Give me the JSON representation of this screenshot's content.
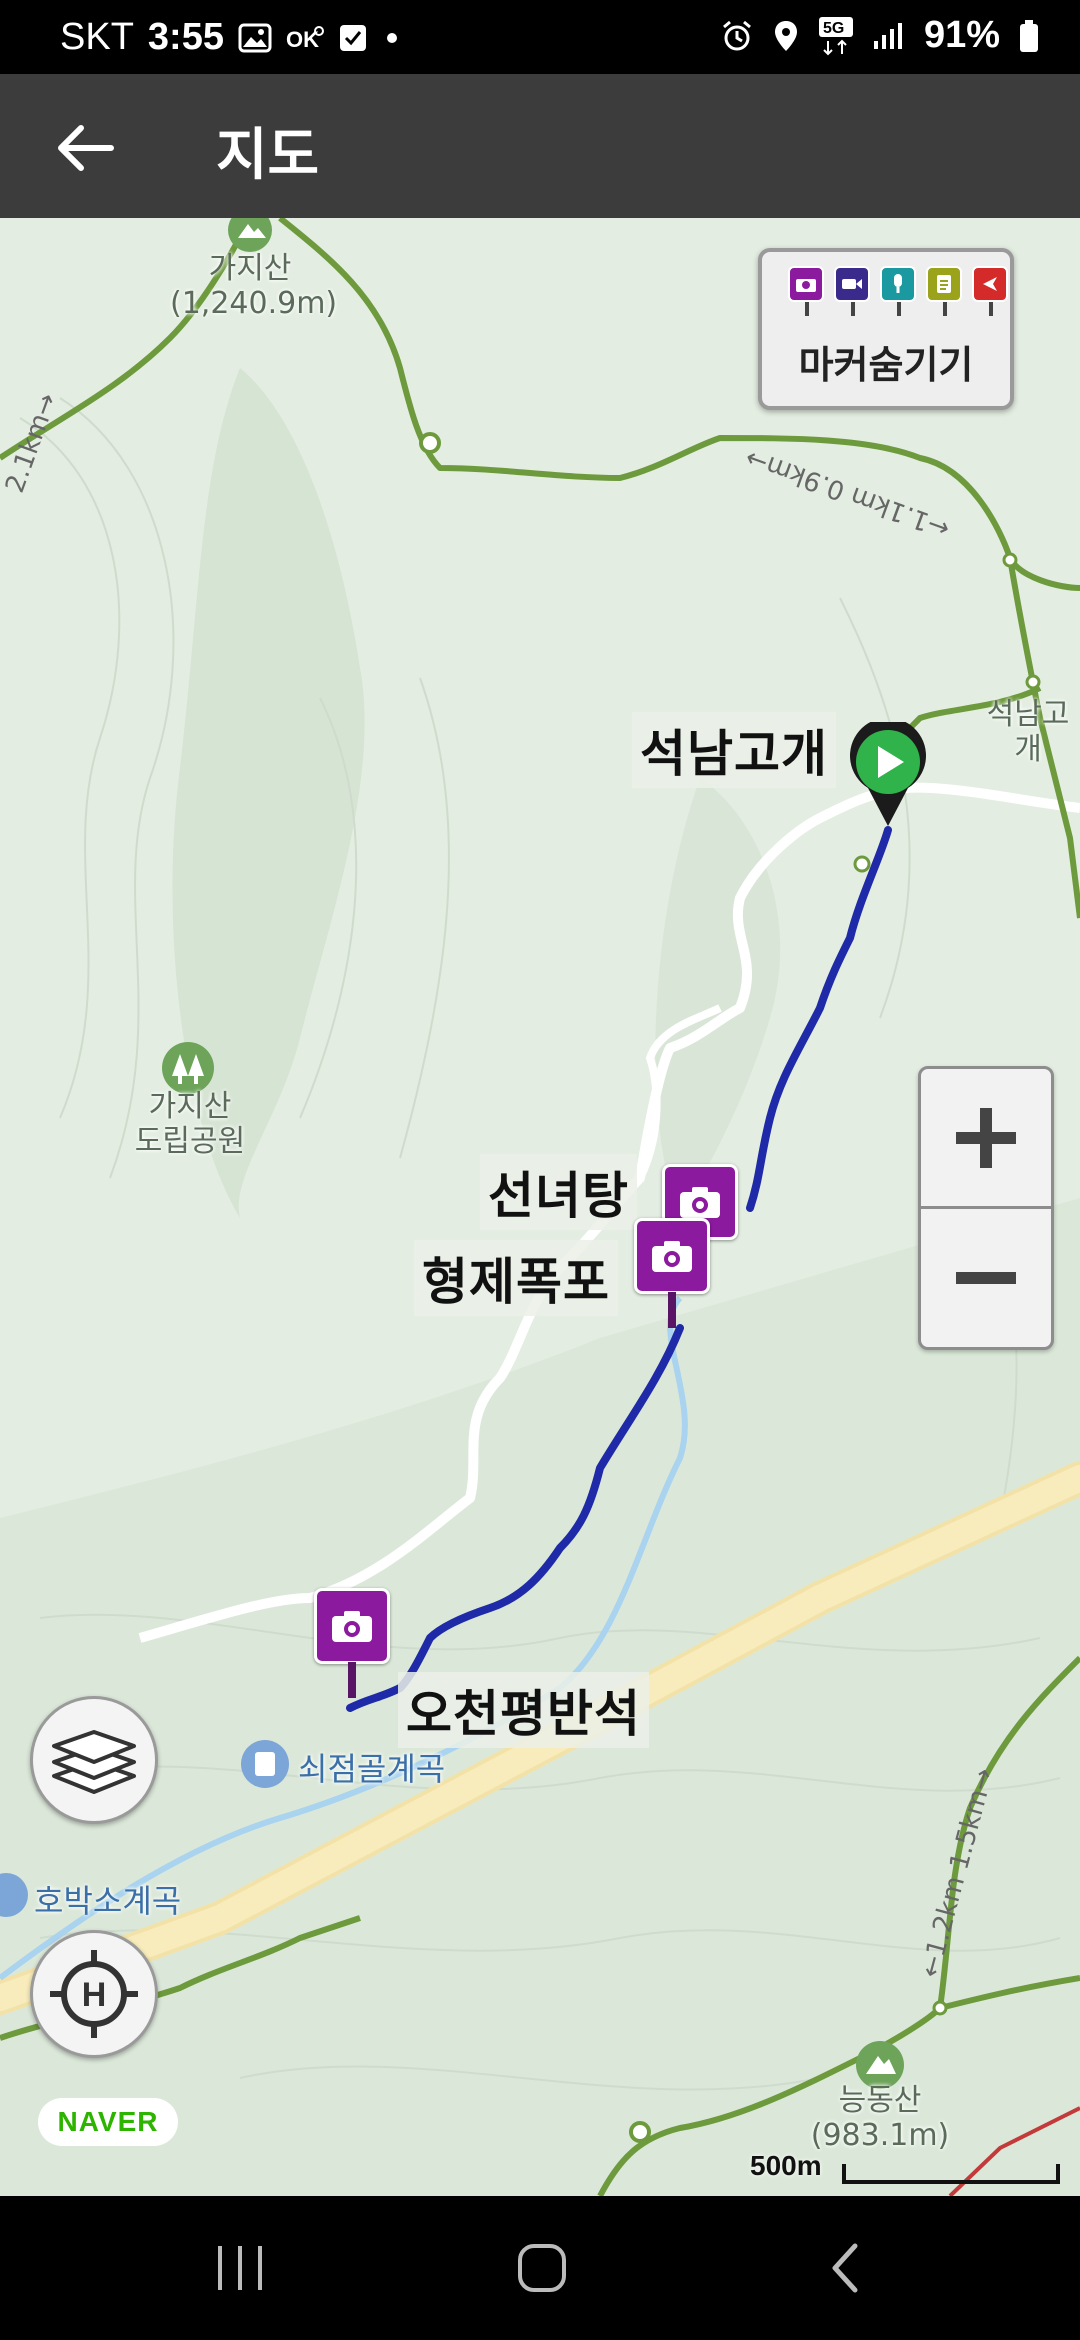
{
  "status_bar": {
    "carrier": "SKT",
    "time": "3:55",
    "network": "5G",
    "battery": "91%"
  },
  "app_bar": {
    "title": "지도"
  },
  "map": {
    "marker_panel_label": "마커숨기기",
    "marker_pin_colors": [
      "#8b1a9e",
      "#3a2a8c",
      "#1a9aa0",
      "#9aa31a",
      "#d42a2a"
    ],
    "peaks": {
      "gajisan": {
        "name": "가지산",
        "elev": "(1,240.9m)"
      },
      "neungdongsan": {
        "name": "능동산",
        "elev": "(983.1m)"
      }
    },
    "park": {
      "line1": "가지산",
      "line2": "도립공원"
    },
    "poi_labels": {
      "seoknam_gogae": "석남고개",
      "seonnyeotang": "선녀탕",
      "hyeongje_pokpo": "형제폭포",
      "ocheon_pyeongbanseok": "오천평반석"
    },
    "small_labels": {
      "seoknam_right": "석남고개",
      "soejeomgol": "쇠점골계곡",
      "hobakso": "호박소계곡"
    },
    "trail_labels": {
      "top_right": "←1.1km 0.9km→",
      "left_edge": "2.1km→",
      "bottom_right": "←1.2km 1.5km→"
    },
    "naver_logo": "NAVER",
    "scale_label": "500m",
    "route_color": "#1f2aa8",
    "accent_green": "#2db400"
  },
  "nav_bar": {
    "recent_icon": "recent-apps-icon",
    "home_icon": "home-icon",
    "back_icon": "back-icon"
  }
}
